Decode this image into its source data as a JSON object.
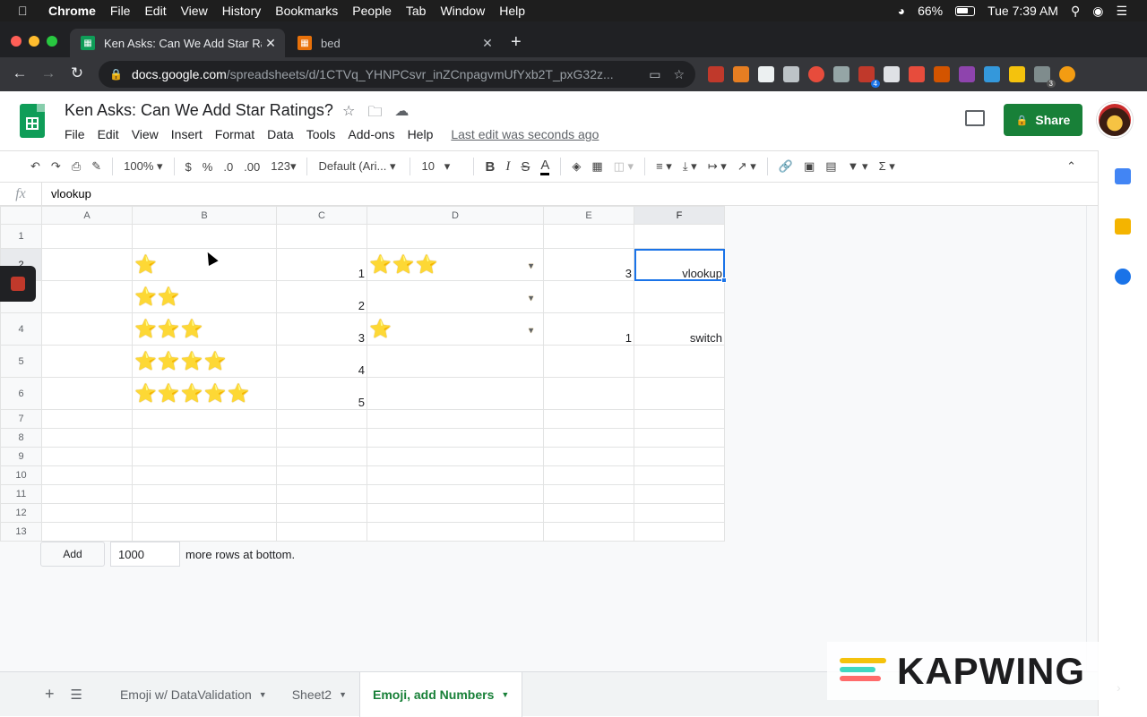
{
  "mac_menubar": {
    "app": "Chrome",
    "items": [
      "File",
      "Edit",
      "View",
      "History",
      "Bookmarks",
      "People",
      "Tab",
      "Window",
      "Help"
    ],
    "battery": "66%",
    "clock": "Tue 7:39 AM"
  },
  "browser": {
    "tabs": [
      {
        "title": "Ken Asks: Can We Add Star Ratings?",
        "active": true
      },
      {
        "title": "bed",
        "active": false
      }
    ],
    "url_host": "docs.google.com",
    "url_path": "/spreadsheets/d/1CTVq_YHNPCsvr_inZCnpagvmUfYxb2T_pxG32z...",
    "ext_badges": [
      "4",
      "3"
    ]
  },
  "sheets": {
    "doc_title": "Ken Asks: Can We Add Star Ratings?",
    "menu": [
      "File",
      "Edit",
      "View",
      "Insert",
      "Format",
      "Data",
      "Tools",
      "Add-ons",
      "Help"
    ],
    "last_edit": "Last edit was seconds ago",
    "share_label": "Share",
    "toolbar": {
      "zoom": "100%",
      "currency": "$",
      "percent": "%",
      "dec_less": ".0",
      "dec_more": ".00",
      "more_formats": "123",
      "font": "Default (Ari...",
      "size": "10",
      "bold": "B",
      "italic": "I",
      "strike": "S",
      "text_color": "A",
      "functions": "Σ"
    },
    "formula_bar": {
      "fx": "fx",
      "value": "vlookup"
    },
    "columns": [
      "A",
      "B",
      "C",
      "D",
      "E",
      "F"
    ],
    "selected_column": "F",
    "rows": [
      {
        "n": "1",
        "A": "",
        "B": "",
        "C": "",
        "D": "",
        "E": "",
        "F": ""
      },
      {
        "n": "2",
        "A": "",
        "B": "⭐",
        "C": "1",
        "D": "⭐⭐⭐",
        "E": "3",
        "F": "vlookup"
      },
      {
        "n": "3",
        "A": "",
        "B": "⭐⭐",
        "C": "2",
        "D": "",
        "E": "",
        "F": ""
      },
      {
        "n": "4",
        "A": "",
        "B": "⭐⭐⭐",
        "C": "3",
        "D": "⭐",
        "E": "1",
        "F": "switch"
      },
      {
        "n": "5",
        "A": "",
        "B": "⭐⭐⭐⭐",
        "C": "4",
        "D": "",
        "E": "",
        "F": ""
      },
      {
        "n": "6",
        "A": "",
        "B": "⭐⭐⭐⭐⭐",
        "C": "5",
        "D": "",
        "E": "",
        "F": ""
      },
      {
        "n": "7"
      },
      {
        "n": "8"
      },
      {
        "n": "9"
      },
      {
        "n": "10"
      },
      {
        "n": "11"
      },
      {
        "n": "12"
      },
      {
        "n": "13"
      }
    ],
    "add_rows": {
      "button": "Add",
      "count": "1000",
      "suffix": "more rows at bottom."
    },
    "sheet_tabs": [
      "Emoji w/ DataValidation",
      "Sheet2",
      "Emoji, add Numbers"
    ],
    "active_sheet": "Emoji, add Numbers"
  },
  "watermark": "KAPWING",
  "colors": {
    "sheets_green": "#188038",
    "selection_blue": "#1a73e8",
    "star_gold": "#f4c430"
  }
}
